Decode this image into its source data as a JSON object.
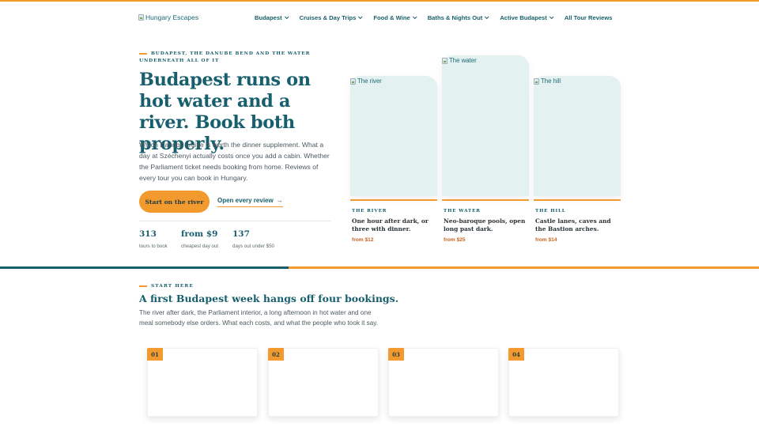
{
  "header": {
    "logo_alt": "Hungary Escapes",
    "nav": [
      {
        "label": "Budapest",
        "has_dropdown": true
      },
      {
        "label": "Cruises & Day Trips",
        "has_dropdown": true
      },
      {
        "label": "Food & Wine",
        "has_dropdown": true
      },
      {
        "label": "Baths & Nights Out",
        "has_dropdown": true
      },
      {
        "label": "Active Budapest",
        "has_dropdown": true
      },
      {
        "label": "All Tour Reviews",
        "has_dropdown": false
      }
    ]
  },
  "hero": {
    "eyebrow": "Budapest, the Danube Bend and the water underneath all of it",
    "title": "Budapest runs on hot water and a river. Book both properly.",
    "subtitle": "Which Danube cruise is worth the dinner supplement. What a day at Széchenyi actually costs once you add a cabin. Whether the Parliament ticket needs booking from home. Reviews of every tour you can book in Hungary.",
    "primary_cta": "Start on the river",
    "secondary_cta": "Open every review",
    "secondary_cta_arrow": "→",
    "stats": [
      {
        "value": "313",
        "label": "tours to book"
      },
      {
        "value": "from $9",
        "label": "cheapest day out"
      },
      {
        "value": "137",
        "label": "days out under $50"
      }
    ],
    "cards": [
      {
        "img_alt": "The river",
        "kicker": "The river",
        "title": "One hour after dark, or three with dinner.",
        "price": "from $12"
      },
      {
        "img_alt": "The water",
        "kicker": "The water",
        "title": "Neo-baroque pools, open long past dark.",
        "price": "from $25"
      },
      {
        "img_alt": "The hill",
        "kicker": "The hill",
        "title": "Castle lanes, caves and the Bastion arches.",
        "price": "from $14"
      }
    ]
  },
  "start_here": {
    "eyebrow": "START HERE",
    "title": "A first Budapest week hangs off four bookings.",
    "subtitle": "The river after dark, the Parliament interior, a long afternoon in hot water and one meal somebody else orders. What each costs, and what the people who took it say.",
    "steps": [
      "01",
      "02",
      "03",
      "04"
    ]
  },
  "colors": {
    "accent": "#f39a2f",
    "brand": "#175f6c",
    "card_bg": "#e3f1f1",
    "price": "#c8611f"
  },
  "icons": {
    "broken_image": "broken-image-icon",
    "dropdown": "chevron-down-icon",
    "arrow": "arrow-right-icon"
  }
}
